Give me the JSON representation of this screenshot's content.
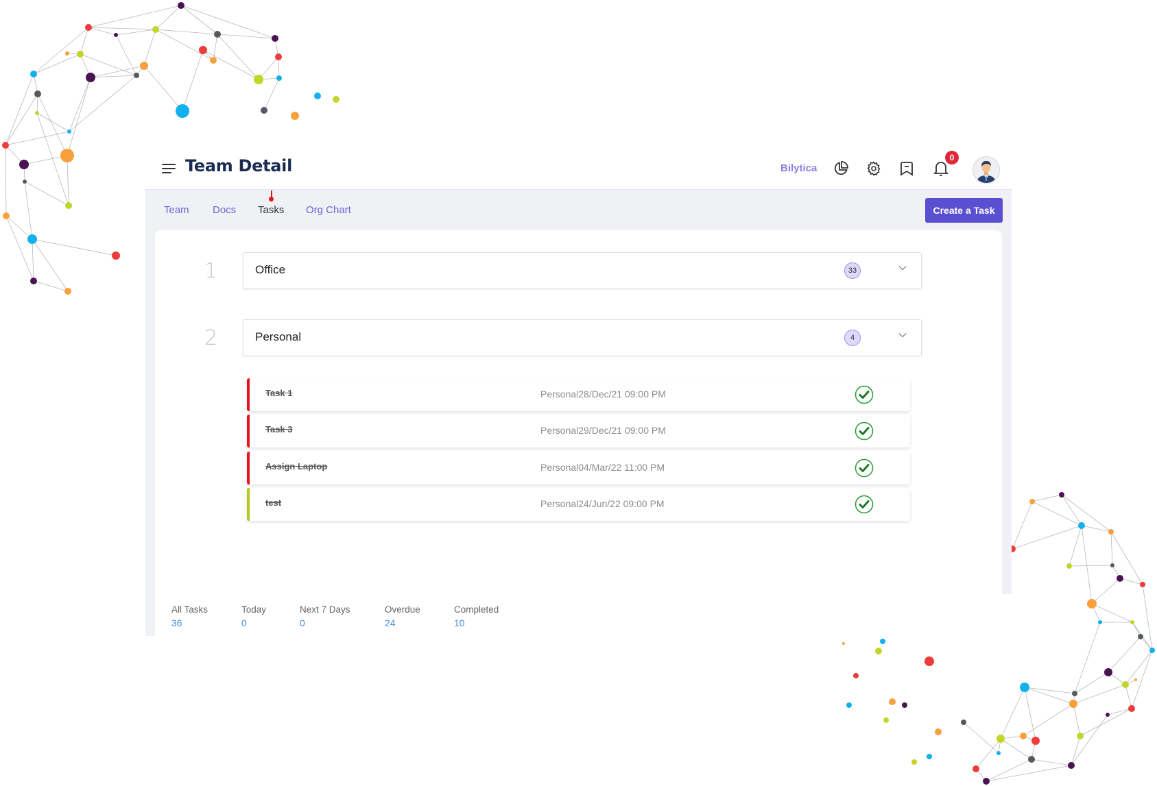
{
  "header": {
    "title": "Team Detail",
    "brand": "Bilytica",
    "notifications_count": "0",
    "icons": [
      "menu-icon",
      "pie-chart-icon",
      "gear-icon",
      "bookmark-icon",
      "bell-icon",
      "user-avatar"
    ]
  },
  "tabs": [
    {
      "label": "Team",
      "active": false
    },
    {
      "label": "Docs",
      "active": false
    },
    {
      "label": "Tasks",
      "active": true
    },
    {
      "label": "Org Chart",
      "active": false
    }
  ],
  "actions": {
    "create_task": "Create a Task"
  },
  "groups": [
    {
      "index": "1",
      "label": "Office",
      "count": "33",
      "expanded": false
    },
    {
      "index": "2",
      "label": "Personal",
      "count": "4",
      "expanded": true
    }
  ],
  "tasks": [
    {
      "name": "Task 1",
      "meta": "Personal28/Dec/21 09:00 PM",
      "status": "completed",
      "priority_color": "#e8121d"
    },
    {
      "name": "Task 3",
      "meta": "Personal29/Dec/21 09:00 PM",
      "status": "completed",
      "priority_color": "#e8121d"
    },
    {
      "name": "Assign Laptop",
      "meta": "Personal04/Mar/22 11:00 PM",
      "status": "completed",
      "priority_color": "#e8121d"
    },
    {
      "name": "test",
      "meta": "Personal24/Jun/22 09:00 PM",
      "status": "completed",
      "priority_color": "#b5c71a"
    }
  ],
  "stats": [
    {
      "label": "All Tasks",
      "value": "36"
    },
    {
      "label": "Today",
      "value": "0"
    },
    {
      "label": "Next 7 Days",
      "value": "0"
    },
    {
      "label": "Overdue",
      "value": "24"
    },
    {
      "label": "Completed",
      "value": "10"
    }
  ],
  "colors": {
    "accent": "#5b4fd1",
    "tab_link": "#6a62d8",
    "brand": "#8b7fe8",
    "check": "#1f8a2a",
    "stat_value": "#4b8fe2",
    "badge": "#e0283c"
  }
}
